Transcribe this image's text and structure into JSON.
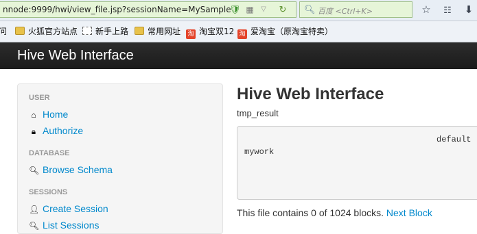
{
  "browser": {
    "url": "nnode:9999/hwi/view_file.jsp?sessionName=MySample",
    "search_placeholder": "百度 <Ctrl+K>",
    "icons": [
      "shield-check-icon",
      "qr-code-icon",
      "dropdown-icon",
      "refresh-icon",
      "search-icon",
      "star-icon",
      "reading-list-icon",
      "download-icon"
    ],
    "bookmarks": [
      {
        "label": "问",
        "icon": "none"
      },
      {
        "label": "火狐官方站点",
        "icon": "folder-icon"
      },
      {
        "label": "新手上路",
        "icon": "page-icon"
      },
      {
        "label": "常用网址",
        "icon": "folder-icon"
      },
      {
        "label": "淘宝双12",
        "icon": "taobao-icon"
      },
      {
        "label": "爱淘宝（原淘宝特卖）",
        "icon": "taobao-icon"
      }
    ],
    "taobao_badge": "淘"
  },
  "navbar": {
    "brand": "Hive Web Interface"
  },
  "sidebar": {
    "sections": [
      {
        "header": "USER",
        "items": [
          {
            "label": "Home",
            "icon": "home-icon"
          },
          {
            "label": "Authorize",
            "icon": "lock-icon"
          }
        ]
      },
      {
        "header": "DATABASE",
        "items": [
          {
            "label": "Browse Schema",
            "icon": "search-icon"
          }
        ]
      },
      {
        "header": "SESSIONS",
        "items": [
          {
            "label": "Create Session",
            "icon": "user-icon"
          },
          {
            "label": "List Sessions",
            "icon": "search-icon"
          }
        ]
      }
    ]
  },
  "main": {
    "title": "Hive Web Interface",
    "file_name": "tmp_result",
    "file_lines": [
      "default",
      "mywork"
    ],
    "status_prefix": "This file contains 0 of 1024 blocks.",
    "next_link": "Next Block"
  }
}
